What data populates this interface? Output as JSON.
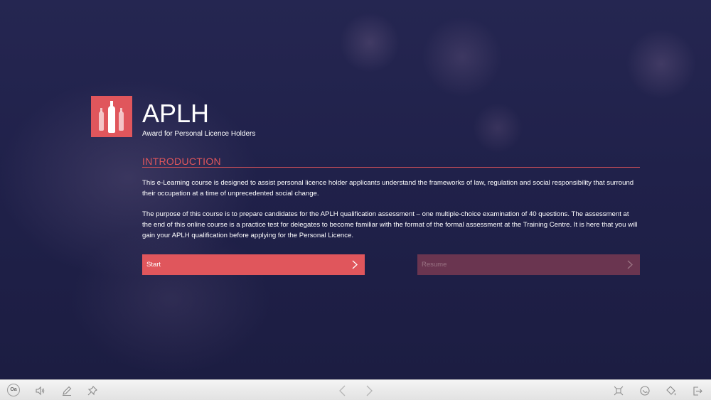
{
  "course": {
    "title": "APLH",
    "subtitle": "Award for Personal Licence Holders"
  },
  "intro": {
    "heading": "INTRODUCTION",
    "paragraph1": "This e-Learning course is designed to assist personal licence holder applicants understand the frameworks of law, regulation and social responsibility that surround their occupation at a time of unprecedented social change.",
    "paragraph2": "The purpose of this course is to prepare candidates for the APLH qualification assessment – one multiple-choice examination of 40 questions. The assessment at the end of this online course is a practice test for delegates to become familiar with the format of the formal assessment at the Training Centre. It is here that you will gain your APLH qualification before applying for the Personal Licence."
  },
  "actions": {
    "start_label": "Start",
    "resume_label": "Resume"
  },
  "toolbar": {
    "font_size_label": "Oa",
    "icons": [
      "font-size-icon",
      "audio-icon",
      "pen-icon",
      "pin-icon",
      "back-arrow-icon",
      "forward-arrow-icon",
      "fullscreen-icon",
      "help-icon",
      "fill-icon",
      "exit-icon"
    ]
  },
  "colors": {
    "accent": "#e0565c",
    "background": "#1e1f45",
    "resume_disabled": "#6a3550",
    "toolbar": "#eeeeee"
  }
}
